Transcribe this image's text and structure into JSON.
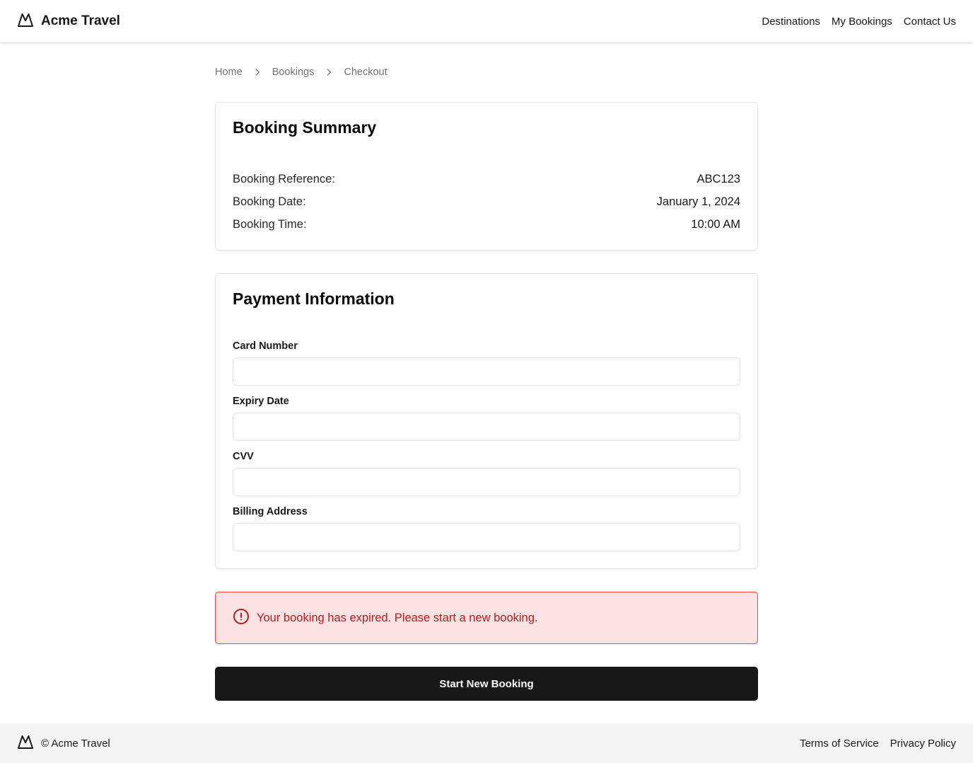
{
  "header": {
    "brand": "Acme Travel",
    "nav": [
      "Destinations",
      "My Bookings",
      "Contact Us"
    ]
  },
  "breadcrumb": [
    "Home",
    "Bookings",
    "Checkout"
  ],
  "summary": {
    "title": "Booking Summary",
    "rows": [
      {
        "label": "Booking Reference:",
        "value": "ABC123"
      },
      {
        "label": "Booking Date:",
        "value": "January 1, 2024"
      },
      {
        "label": "Booking Time:",
        "value": "10:00 AM"
      }
    ]
  },
  "payment": {
    "title": "Payment Information",
    "fields": [
      {
        "label": "Card Number",
        "value": "",
        "placeholder": ""
      },
      {
        "label": "Expiry Date",
        "value": "",
        "placeholder": ""
      },
      {
        "label": "CVV",
        "value": "",
        "placeholder": ""
      },
      {
        "label": "Billing Address",
        "value": "",
        "placeholder": ""
      }
    ]
  },
  "alert": {
    "message": "Your booking has expired. Please start a new booking.",
    "icon": "alert-circle-icon",
    "color": "#b91c1c",
    "background": "#fde2e4"
  },
  "action": {
    "label": "Start New Booking"
  },
  "footer": {
    "copyright": "© Acme Travel",
    "links": [
      "Terms of Service",
      "Privacy Policy"
    ]
  },
  "colors": {
    "primary": "#18181b",
    "muted": "#71717a",
    "border": "#e4e4e7",
    "footer_bg": "#f3f4f6"
  }
}
